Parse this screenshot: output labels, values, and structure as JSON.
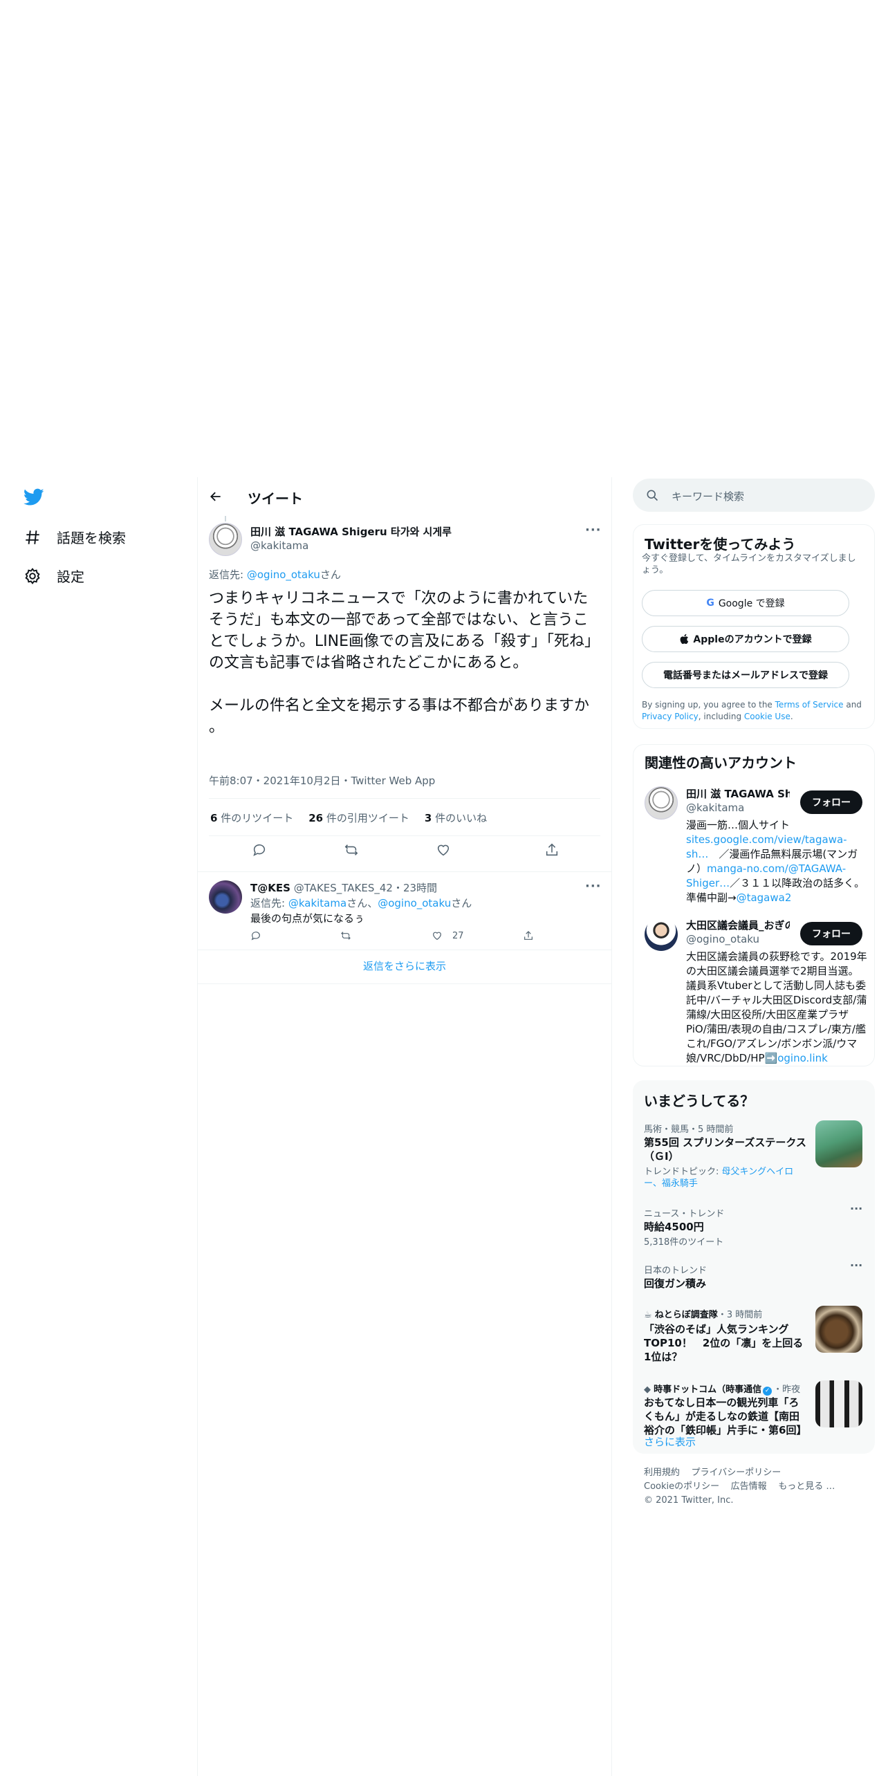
{
  "nav": {
    "explore": "話題を検索",
    "settings": "設定"
  },
  "header": {
    "title": "ツイート"
  },
  "tweet": {
    "name": "田川 滋 TAGAWA Shigeru 타가와 시게루",
    "handle": "@kakitama",
    "reply_prefix": "返信先: ",
    "reply_to": "@ogino_otaku",
    "reply_suffix": "さん",
    "body": "つまりキャリコネニュースで「次のように書かれていたそうだ」も本文の一部であって全部ではない、と言うことでしょうか。LINE画像での言及にある「殺す」「死ね」の文言も記事では省略されたどこかにあると。\n\nメールの件名と全文を掲示する事は不都合がありますか\n。",
    "meta": "午前8:07・2021年10月2日・Twitter Web App",
    "retweets_count": "6",
    "retweets_label": "件のリツイート",
    "quotes_count": "26",
    "quotes_label": "件の引用ツイート",
    "likes_count": "3",
    "likes_label": "件のいいね"
  },
  "reply": {
    "name": "T@KES",
    "handle_time": "@TAKES_TAKES_42・23時間",
    "reply_prefix": "返信先: ",
    "reply_to_1": "@kakitama",
    "reply_mid": "さん、",
    "reply_to_2": "@ogino_otaku",
    "reply_suffix": "さん",
    "text": "最後の句点が気になるぅ",
    "likes": "27"
  },
  "show_more_replies": "返信をさらに表示",
  "search": {
    "placeholder": "キーワード検索"
  },
  "signup": {
    "title": "Twitterを使ってみよう",
    "subtitle": "今すぐ登録して、タイムラインをカスタマイズしましょう。",
    "google": "Google で登録",
    "apple": "Appleのアカウントで登録",
    "phone": "電話番号またはメールアドレスで登録",
    "terms_1": "By signing up, you agree to the ",
    "terms_link_1": "Terms of Service",
    "terms_2": " and ",
    "terms_link_2": "Privacy Policy",
    "terms_3": ", including ",
    "terms_link_3": "Cookie Use",
    "terms_4": "."
  },
  "related": {
    "title": "関連性の高いアカウント",
    "accounts": [
      {
        "name": "田川 滋 TAGAWA Shigeru 타가와 시게루",
        "handle": "@kakitama",
        "follow": "フォロー",
        "bio_1": "漫画一筋…個人サイト",
        "bio_link_1": "sites.google.com/view/tagawa-sh…",
        "bio_2": "　／漫画作品無料展示場(マンガノ）",
        "bio_link_2": "manga-no.com/@TAGAWA-Shiger…",
        "bio_3": "／３１１以降政治の話多く。準備中副→",
        "bio_link_3": "@tagawa2"
      },
      {
        "name": "大田区議会議員_おぎの稔",
        "handle": "@ogino_otaku",
        "follow": "フォロー",
        "bio_1": "大田区議会議員の荻野稔です。2019年の大田区議会議員選挙で2期目当選。議員系Vtuberとして活動し同人誌も委託中/バーチャル大田区Discord支部/蒲蒲線/大田区役所/大田区産業プラザPiO/蒲田/表現の自由/コスプレ/東方/艦これ/FGO/アズレン/ボンボン派/ウマ娘/VRC/DbD/HP",
        "bio_emoji": "➡️",
        "bio_link": "ogino.link"
      }
    ]
  },
  "trends": {
    "title": "いまどうしてる？",
    "items": [
      {
        "meta": "馬術・競馬・5 時間前",
        "title": "第55回 スプリンターズステークス（ＧⅠ）",
        "sub_label": "トレンドトピック: ",
        "sub_link": "母父キングヘイロー、福永騎手"
      },
      {
        "meta": "ニュース・トレンド",
        "title": "時給4500円",
        "count": "5,318件のツイート"
      },
      {
        "meta": "日本のトレンド",
        "title": "回復ガン積み"
      },
      {
        "source": "ねとらぼ調査隊",
        "time": "・3 時間前",
        "title": "「渋谷のそば」人気ランキングTOP10！　2位の「凛」を上回る1位は？"
      },
      {
        "source": "時事ドットコム（時事通信",
        "time": "・昨夜",
        "title": "おもてなし日本一の観光列車「ろくもん」が走るしなの鉄道【南田裕介の「鉄印帳」片手に・第6回】"
      }
    ],
    "show_more": "さらに表示"
  },
  "footer": {
    "terms": "利用規約",
    "privacy": "プライバシーポリシー",
    "cookie": "Cookieのポリシー",
    "ads": "広告情報",
    "more": "もっと見る …",
    "copyright": "© 2021 Twitter, Inc."
  },
  "colors": {
    "accent": "#1d9bf0",
    "text": "#0f1419",
    "muted": "#536471",
    "border": "#eff3f4"
  }
}
